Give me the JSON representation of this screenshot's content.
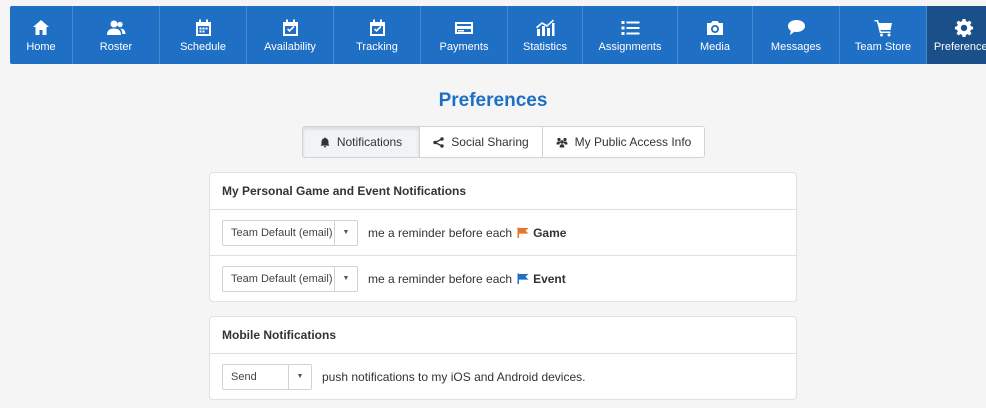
{
  "nav": {
    "items": [
      {
        "label": "Home",
        "icon": "home-icon"
      },
      {
        "label": "Roster",
        "icon": "users-icon"
      },
      {
        "label": "Schedule",
        "icon": "calendar-icon"
      },
      {
        "label": "Availability",
        "icon": "calendar-check-icon"
      },
      {
        "label": "Tracking",
        "icon": "calendar-check-icon"
      },
      {
        "label": "Payments",
        "icon": "credit-card-icon"
      },
      {
        "label": "Statistics",
        "icon": "bar-chart-icon"
      },
      {
        "label": "Assignments",
        "icon": "list-icon"
      },
      {
        "label": "Media",
        "icon": "camera-icon"
      },
      {
        "label": "Messages",
        "icon": "chat-bubble-icon"
      },
      {
        "label": "Team Store",
        "icon": "cart-icon"
      },
      {
        "label": "Preferences",
        "icon": "gear-icon"
      }
    ],
    "active": "Preferences",
    "color": "#1f6fc5",
    "active_color": "#1a4f8a"
  },
  "page_title": "Preferences",
  "tabs": [
    {
      "label": "Notifications",
      "icon": "bell-icon"
    },
    {
      "label": "Social Sharing",
      "icon": "share-icon"
    },
    {
      "label": "My Public Access Info",
      "icon": "people-icon"
    }
  ],
  "active_tab": "Notifications",
  "personal": {
    "heading": "My Personal Game and Event Notifications",
    "rows": [
      {
        "select_value": "Team Default (email)",
        "text": "me a reminder before each",
        "flag_color": "#e8732a",
        "kind": "Game"
      },
      {
        "select_value": "Team Default (email)",
        "text": "me a reminder before each",
        "flag_color": "#1f6fc5",
        "kind": "Event"
      }
    ]
  },
  "mobile": {
    "heading": "Mobile Notifications",
    "select_value": "Send",
    "text": "push notifications to my iOS and Android devices."
  }
}
